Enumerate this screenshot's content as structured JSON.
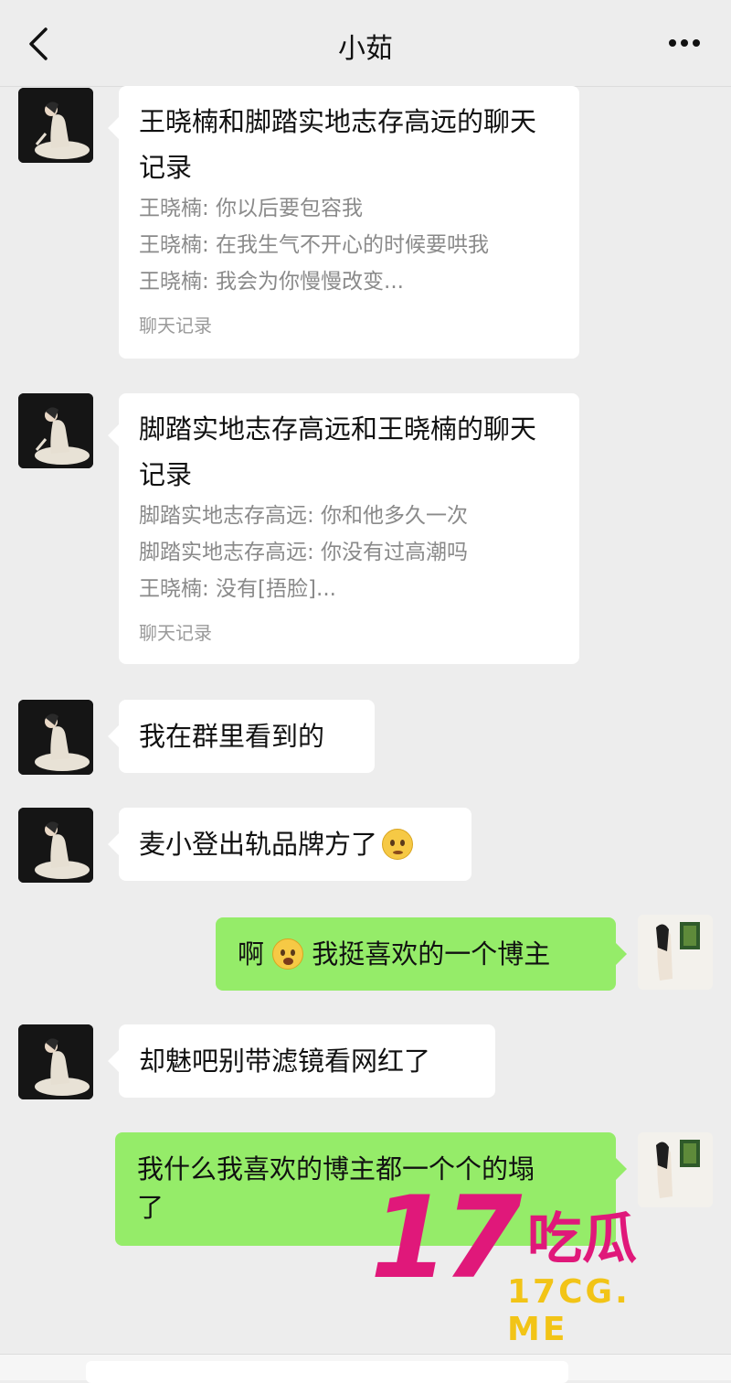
{
  "header": {
    "title": "小茹",
    "back_icon": "chevron-left-icon",
    "more_icon": "ellipsis-icon"
  },
  "messages": [
    {
      "type": "chat-record-card",
      "title": "王晓楠和脚踏实地志存高远的聊天记录",
      "lines": [
        "王晓楠: 你以后要包容我",
        "王晓楠: 在我生气不开心的时候要哄我",
        "王晓楠: 我会为你慢慢改变..."
      ],
      "footer": "聊天记录"
    },
    {
      "type": "chat-record-card",
      "title": "脚踏实地志存高远和王晓楠的聊天记录",
      "lines": [
        "脚踏实地志存高远: 你和他多久一次",
        "脚踏实地志存高远: 你没有过高潮吗",
        "王晓楠: 没有[捂脸]..."
      ],
      "footer": "聊天记录"
    },
    {
      "type": "text",
      "side": "left",
      "text": "我在群里看到的"
    },
    {
      "type": "text",
      "side": "left",
      "text": "麦小登出轨品牌方了",
      "emoji": "pleading-face-emoji"
    },
    {
      "type": "text",
      "side": "right",
      "pre": "啊",
      "emoji": "surprised-face-emoji",
      "text": "我挺喜欢的一个博主"
    },
    {
      "type": "text",
      "side": "left",
      "text": "却魅吧别带滤镜看网红了"
    },
    {
      "type": "text",
      "side": "right",
      "lines": [
        "我什么我喜欢的博主都一个个的塌",
        "了"
      ]
    }
  ],
  "watermark": {
    "number": "17",
    "chinese": "吃瓜",
    "domain": "17CG. ME"
  },
  "colors": {
    "background": "#ededed",
    "bubble_green": "#95ec69",
    "bubble_white": "#ffffff",
    "watermark_pink": "#e0187a",
    "watermark_yellow": "#f2c417"
  }
}
